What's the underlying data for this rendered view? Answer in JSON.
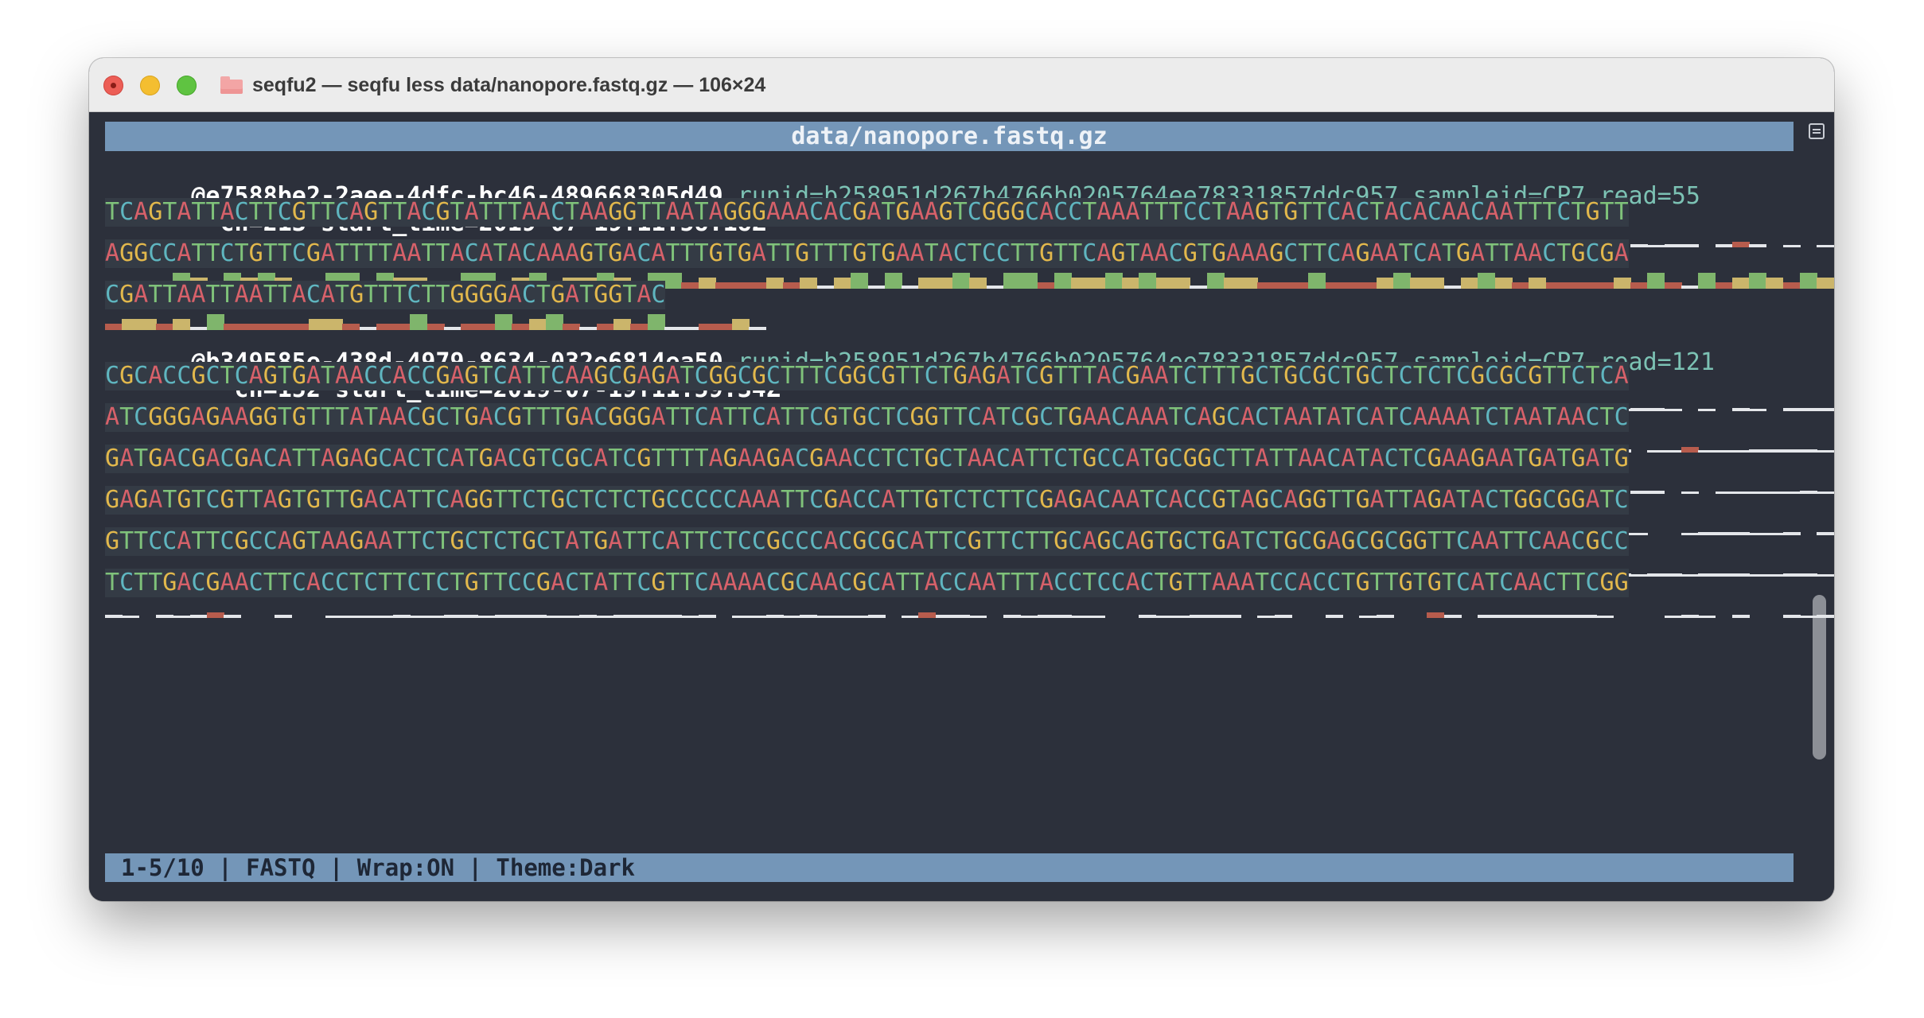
{
  "window": {
    "title": "seqfu2 — seqfu less data/nanopore.fastq.gz — 106×24",
    "folder_icon": "folder-icon"
  },
  "header_bar": {
    "text": "data/nanopore.fastq.gz"
  },
  "colors": {
    "A": "#d7616a",
    "C": "#5fb6c0",
    "G": "#e2b84c",
    "T": "#7fc27a",
    "header_bar": "#7496b8",
    "background": "#2c303b",
    "quality_high": "#7fb56c",
    "quality_mid": "#cbb56b",
    "quality_low": "#b75c4d",
    "quality_line": "#e4e6ea"
  },
  "records": [
    {
      "id": "@e7588be2-2aee-4dfc-bc46-489668305d49",
      "attrs": " runid=b258951d267b4766b0205764ee78331857ddc957 sampleid=CP7 read=55",
      "cont": "  ch=213 start_time=2019-07-19T11:58:18Z",
      "sequence_lines": [
        "TCAGTATTACTTCGTTCAGTTACGTATTTAACTAAGGTTAATAGGGAAACACGATGAAGTCGGGCACCTAAATTTCCTAAGTGTTCACTACACAACAATTTCTGTT",
        "AGGCCATTCTGTTCGATTTTAATTACATACAAAGTGACATTTGTGATTGTTTGTGAATACTCCTTGTTCAGTAACGTGAAAGCTTCAGAATCATGATTAACTGCGA",
        "CGATTAATTAATTACATGTTTCTTGGGGACTGATGGTAC"
      ]
    },
    {
      "id": "@b349585e-438d-4979-8634-032e6814ea50",
      "attrs": " runid=b258951d267b4766b0205764ee78331857ddc957 sampleid=CP7 read=121",
      "cont": "   ch=152 start_time=2019-07-19T11:59:34Z",
      "sequence_lines": [
        "CGCACCGCTCAGTGATAACCACCGAGTCATTCAAGCGAGATCGGCGCTTTCGGCGTTCTGAGATCGTTTACGAATCTTTGCTGCGCTGCTCTCTCGCGCGTTCTCA",
        "ATCGGGAGAAGGTGTTTATAACGCTGACGTTTGACGGGATTCATTCATTCGTGCTCGGTTCATCGCTGAACAAATCAGCACTAATATCATCAAAATCTAATAACTC",
        "GATGACGACGACATTAGAGCACTCATGACGTCGCATCGTTTTAGAAGACGAACCTCTGCTAACATTCTGCCATGCGGCTTATTAACATACTCGAAGAATGATGATG",
        "GAGATGTCGTTAGTGTTGACATTCAGGTTCTGCTCTCTGCCCCCAAATTCGACCATTGTCTCTTCGAGACAATCACCGTAGCAGGTTGATTAGATACTGGCGGATC",
        "GTTCCATTCGCCAGTAAGAATTCTGCTCTGCTATGATTCATTCTCCGCCCACGCGCATTCGTTCTTGCAGCAGTGCTGATCTGCGAGCGCGGTTCAATTCAACGCC",
        "TCTTGACGAACTTCACCTCTTCTCTGTTCCGACTATTCGTTCAAAACGCAACGCATTACCAATTTACCTCCACTGTTAAATCCACCTGTTGTGTCATCAACTTCGG"
      ]
    }
  ],
  "status_bar": {
    "text": "1-5/10 | FASTQ | Wrap:ON | Theme:Dark"
  },
  "scrollbar": {
    "position": 0.77,
    "visible_fraction": 0.22
  }
}
